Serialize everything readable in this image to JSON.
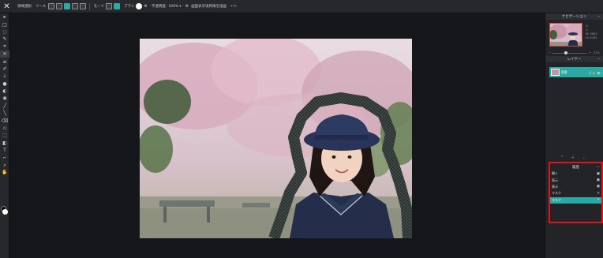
{
  "topbar": {
    "logo": "✕",
    "tool_label": "領域選択",
    "mode_label": "ツール",
    "mode2_label": "モード",
    "brush_label": "ブラシ",
    "opacity_label": "不透明度:",
    "opacity_value": "100%",
    "extra_label": "画面表示境界線を描画",
    "more": "•••"
  },
  "tools": [
    "▸",
    "□",
    "◌",
    "✎",
    "⌗",
    "✕",
    "≡",
    "✐",
    "⊥",
    "●",
    "◐",
    "◉",
    "╱",
    "╲",
    "⌫",
    "◇",
    "⬚",
    "◧",
    "T",
    "⌐",
    "⌕",
    "✋"
  ],
  "navigator": {
    "title": "ナビゲーション",
    "info": [
      "X:",
      "Y:",
      "W:",
      "H:"
    ],
    "values": [
      "",
      "",
      "2642",
      "2035"
    ],
    "zoom_minus": "−",
    "zoom_plus": "+",
    "zoom_value": "22%"
  },
  "layers": {
    "title": "レイヤー",
    "items": [
      {
        "name": "背景",
        "icons": "ⓧ🔒👁"
      }
    ]
  },
  "panel_controls": "^ + ⌄",
  "history": {
    "title": "履歴",
    "items": [
      {
        "label": "開く",
        "icon": "▣"
      },
      {
        "label": "表示",
        "icon": "▣"
      },
      {
        "label": "表示",
        "icon": "▣"
      },
      {
        "label": "マスク",
        "icon": "✕"
      },
      {
        "label": "マスク",
        "icon": "✕",
        "active": true
      }
    ]
  },
  "colors": {
    "accent": "#2aa8a3",
    "highlight_box": "#e0161b",
    "panel_bg": "#222428",
    "canvas_bg": "#16171a"
  }
}
